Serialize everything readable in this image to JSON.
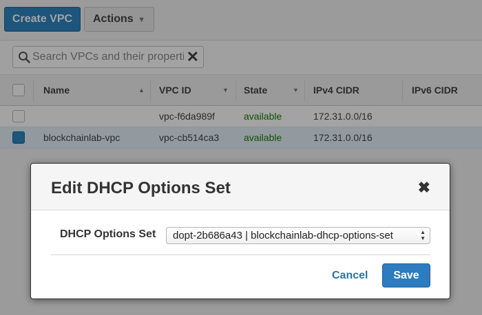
{
  "toolbar": {
    "create_label": "Create VPC",
    "actions_label": "Actions"
  },
  "search": {
    "placeholder": "Search VPCs and their properties"
  },
  "table": {
    "headers": {
      "name": "Name",
      "vpc_id": "VPC ID",
      "state": "State",
      "ipv4": "IPv4 CIDR",
      "ipv6": "IPv6 CIDR"
    },
    "rows": [
      {
        "selected": false,
        "name": "",
        "vpc_id": "vpc-f6da989f",
        "state": "available",
        "ipv4": "172.31.0.0/16"
      },
      {
        "selected": true,
        "name": "blockchainlab-vpc",
        "vpc_id": "vpc-cb514ca3",
        "state": "available",
        "ipv4": "172.31.0.0/16"
      }
    ]
  },
  "modal": {
    "title": "Edit DHCP Options Set",
    "field_label": "DHCP Options Set",
    "selected_option": "dopt-2b686a43 | blockchainlab-dhcp-options-set",
    "cancel_label": "Cancel",
    "save_label": "Save"
  },
  "icons": {
    "search": "search-icon",
    "clear": "clear-icon",
    "close": "close-icon",
    "caret": "chevron-down-icon",
    "sort_up": "sort-asc-icon",
    "sort_down": "sort-desc-icon"
  },
  "colors": {
    "primary": "#2e86c1",
    "state_available": "#1d8102",
    "link": "#2874a6"
  }
}
